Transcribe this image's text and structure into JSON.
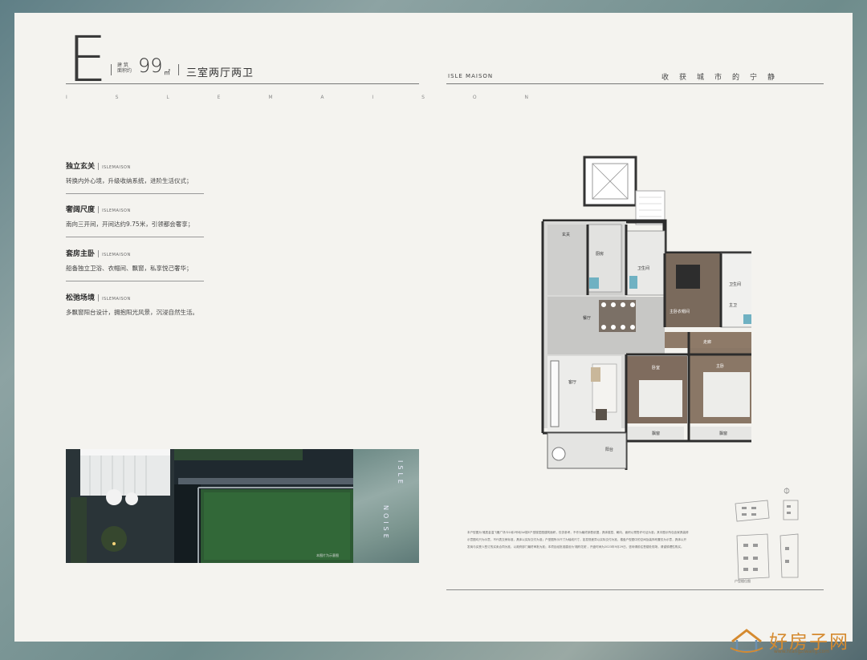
{
  "header": {
    "unit_letter": "E",
    "area_label_line1": "建 筑",
    "area_label_line2": "面积约",
    "area_value": "99",
    "area_unit": "㎡",
    "layout": "三室两厅两卫",
    "spaced_brand": "I S L E M A I S O N",
    "brand": "ISLE MAISON",
    "slogan": "收获城市的宁静"
  },
  "features": [
    {
      "title": "独立玄关",
      "sub": "ISLEMAISON",
      "desc": "转换内外心境，升级收纳系统，进阶生活仪式；"
    },
    {
      "title": "奢阔尺度",
      "sub": "ISLEMAISON",
      "desc": "南向三开间，开间达约9.75米，引领都会奢享；"
    },
    {
      "title": "套房主卧",
      "sub": "ISLEMAISON",
      "desc": "船备独立卫浴、衣帽间、飘窗，私享悦己奢华；"
    },
    {
      "title": "松弛场境",
      "sub": "ISLEMAISON",
      "desc": "多飘窗阳台设计，拥抱阳光风景，沉浸自然生活。"
    }
  ],
  "photo": {
    "caption": "本图片为示意图",
    "side_text_1": "ISLE",
    "side_text_2": "NOISE"
  },
  "floorplan": {
    "rooms": {
      "entry": "玄关",
      "kitchen": "厨房",
      "bath1": "卫生间",
      "dining": "餐厅",
      "master_closet": "主卧衣帽间",
      "bath2": "卫生间",
      "bath3": "主卫",
      "hall": "走廊",
      "living": "客厅",
      "bedroom2": "卧室",
      "master": "主卧",
      "balcony": "阳台",
      "bay1": "飘窗",
      "bay2": "飘窗"
    }
  },
  "footer": {
    "disclaimer": "本户型图为'雅居金温飞雁广场'D1地2号地3#楼E户型楼层图建筑面积，仅供参考，不作为最终销售依据，具体楼层、朝向、面积以预售许可证为准；其中图示所包含家具装修示意图均只为示意，不代表交房标准，具体以实际交付为准；户型图所示尺寸为轴线尺寸，如发现差异以实际交付为准，楼盘户型图中的空间及装饰布置仅为示意，具体以开发商与买受人签订的买卖合同为准，以政府部门最终审批为准；本项目经批准建设为'湘府花苑'，开盘时间为2023年9月29日，咨询请前往售楼处现场，请谨慎理性购买。",
    "keyplan_label": "户型楼位图"
  },
  "watermark": {
    "text": "好房子网",
    "url": "www.hfangziwang.com"
  }
}
